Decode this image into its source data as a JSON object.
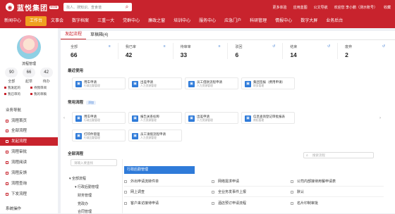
{
  "brand": {
    "logo_text": "蓝悦集团",
    "badge": "测试版"
  },
  "search": {
    "placeholder": "找人、搜知识、查食谱"
  },
  "top_links": [
    "更多体验",
    "应用蓝图",
    "公文导航",
    "欢迎您 李小鹏（测示账号）",
    "收藏"
  ],
  "nav": [
    "新闻中心",
    "工作台",
    "文事会",
    "数字档案",
    "三重一大",
    "党群中心",
    "廉政之窗",
    "培训中心",
    "服务中心",
    "应急门户",
    "科研管理",
    "情报中心",
    "数字大屏",
    "业务后台"
  ],
  "nav_active": 1,
  "user": {
    "name": "流程管理",
    "stats": [
      {
        "value": "90",
        "label": "全部"
      },
      {
        "value": "66",
        "label": "起草"
      },
      {
        "value": "42",
        "label": "待办"
      }
    ],
    "quick_links": [
      "我发起的",
      "待我审阅",
      "我已审的",
      "我的草稿"
    ]
  },
  "sidebar": {
    "section1": "业务导航",
    "items": [
      "流程首页",
      "全部流程",
      "发起流程",
      "流程审批",
      "流程阅读",
      "流程反馈",
      "流程查询",
      "下发流程"
    ],
    "active": 2,
    "section2": "系统操作"
  },
  "tabs": [
    "发起流程",
    "草稿箱(4)"
  ],
  "counts": [
    {
      "label": "全部",
      "value": "66",
      "icon": "≡"
    },
    {
      "label": "我已审",
      "value": "42",
      "icon": "≡"
    },
    {
      "label": "待审审",
      "value": "33",
      "icon": "≡"
    },
    {
      "label": "驳回",
      "value": "6",
      "icon": "↺"
    },
    {
      "label": "结束",
      "value": "14",
      "icon": "↺"
    },
    {
      "label": "废弃",
      "value": "2",
      "icon": "↺"
    }
  ],
  "recent": {
    "title": "最近使用",
    "cards": [
      {
        "t": "用车申请",
        "s": "行政后勤管理"
      },
      {
        "t": "出差申请",
        "s": "人力资源管理"
      },
      {
        "t": "员工借款流程申请",
        "s": "人力资源管理"
      },
      {
        "t": "集团签报（费用申请）",
        "s": "财务管理"
      }
    ]
  },
  "common": {
    "title": "常用流程",
    "chip": "添加",
    "cards": [
      {
        "t": "用车申请",
        "s": "行政后勤管理"
      },
      {
        "t": "报告关系标称",
        "s": "人力资源管理"
      },
      {
        "t": "出差申请",
        "s": "人力资源管理"
      },
      {
        "t": "信息查询登记审批报表",
        "s": "商拓管理"
      },
      {
        "t": "打印件管理",
        "s": "行政后勤管理"
      },
      {
        "t": "员工请假流程申请",
        "s": "人力资源管理"
      }
    ]
  },
  "all": {
    "title": "全部流程",
    "tree_search": "请输入要查找",
    "search_placeholder": "搜索流程",
    "tree": [
      "全部流程",
      "行政后勤管理",
      "财务管理",
      "党政办",
      "合同管理"
    ],
    "group": "行政后勤管理",
    "items": [
      [
        "外出申请流转件单",
        "网络需求申请",
        "公司内部接待用餐申请表"
      ],
      [
        "网上调查",
        "全业务发事件上报",
        "默认"
      ],
      [
        "客户来访接待申请",
        "酒店预订申请流程",
        "名片印制审批"
      ]
    ]
  }
}
